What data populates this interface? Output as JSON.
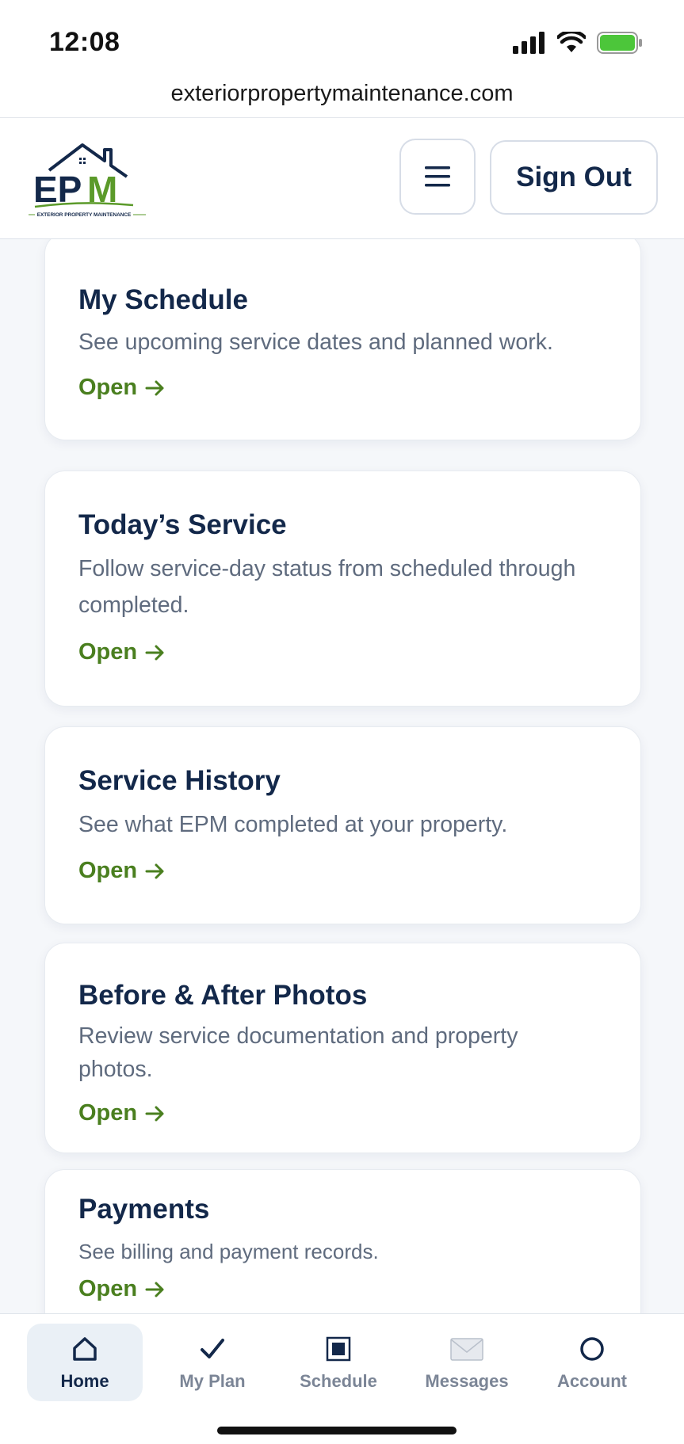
{
  "status": {
    "time": "12:08"
  },
  "browser": {
    "url": "exteriorpropertymaintenance.com"
  },
  "header": {
    "logo_text": "EPM",
    "logo_tagline": "EXTERIOR PROPERTY MAINTENANCE",
    "sign_out_label": "Sign Out"
  },
  "cards": [
    {
      "title": "My Schedule",
      "description": "See upcoming service dates and planned work.",
      "link": "Open"
    },
    {
      "title": "Today’s Service",
      "description": "Follow service-day status from scheduled through completed.",
      "link": "Open"
    },
    {
      "title": "Service History",
      "description": "See what EPM completed at your property.",
      "link": "Open"
    },
    {
      "title": "Before & After Photos",
      "description": "Review service documentation and property photos.",
      "link": "Open"
    },
    {
      "title": "Payments",
      "description": "See billing and payment records.",
      "link": "Open"
    }
  ],
  "nav": [
    {
      "label": "Home",
      "icon": "home-icon",
      "active": true
    },
    {
      "label": "My Plan",
      "icon": "check-icon",
      "active": false
    },
    {
      "label": "Schedule",
      "icon": "schedule-square-icon",
      "active": false
    },
    {
      "label": "Messages",
      "icon": "envelope-icon",
      "active": false
    },
    {
      "label": "Account",
      "icon": "account-circle-icon",
      "active": false
    }
  ],
  "colors": {
    "navy": "#13284a",
    "green_link": "#4a7f1f",
    "logo_green": "#5b9a2a",
    "battery_green": "#4cc63a"
  }
}
